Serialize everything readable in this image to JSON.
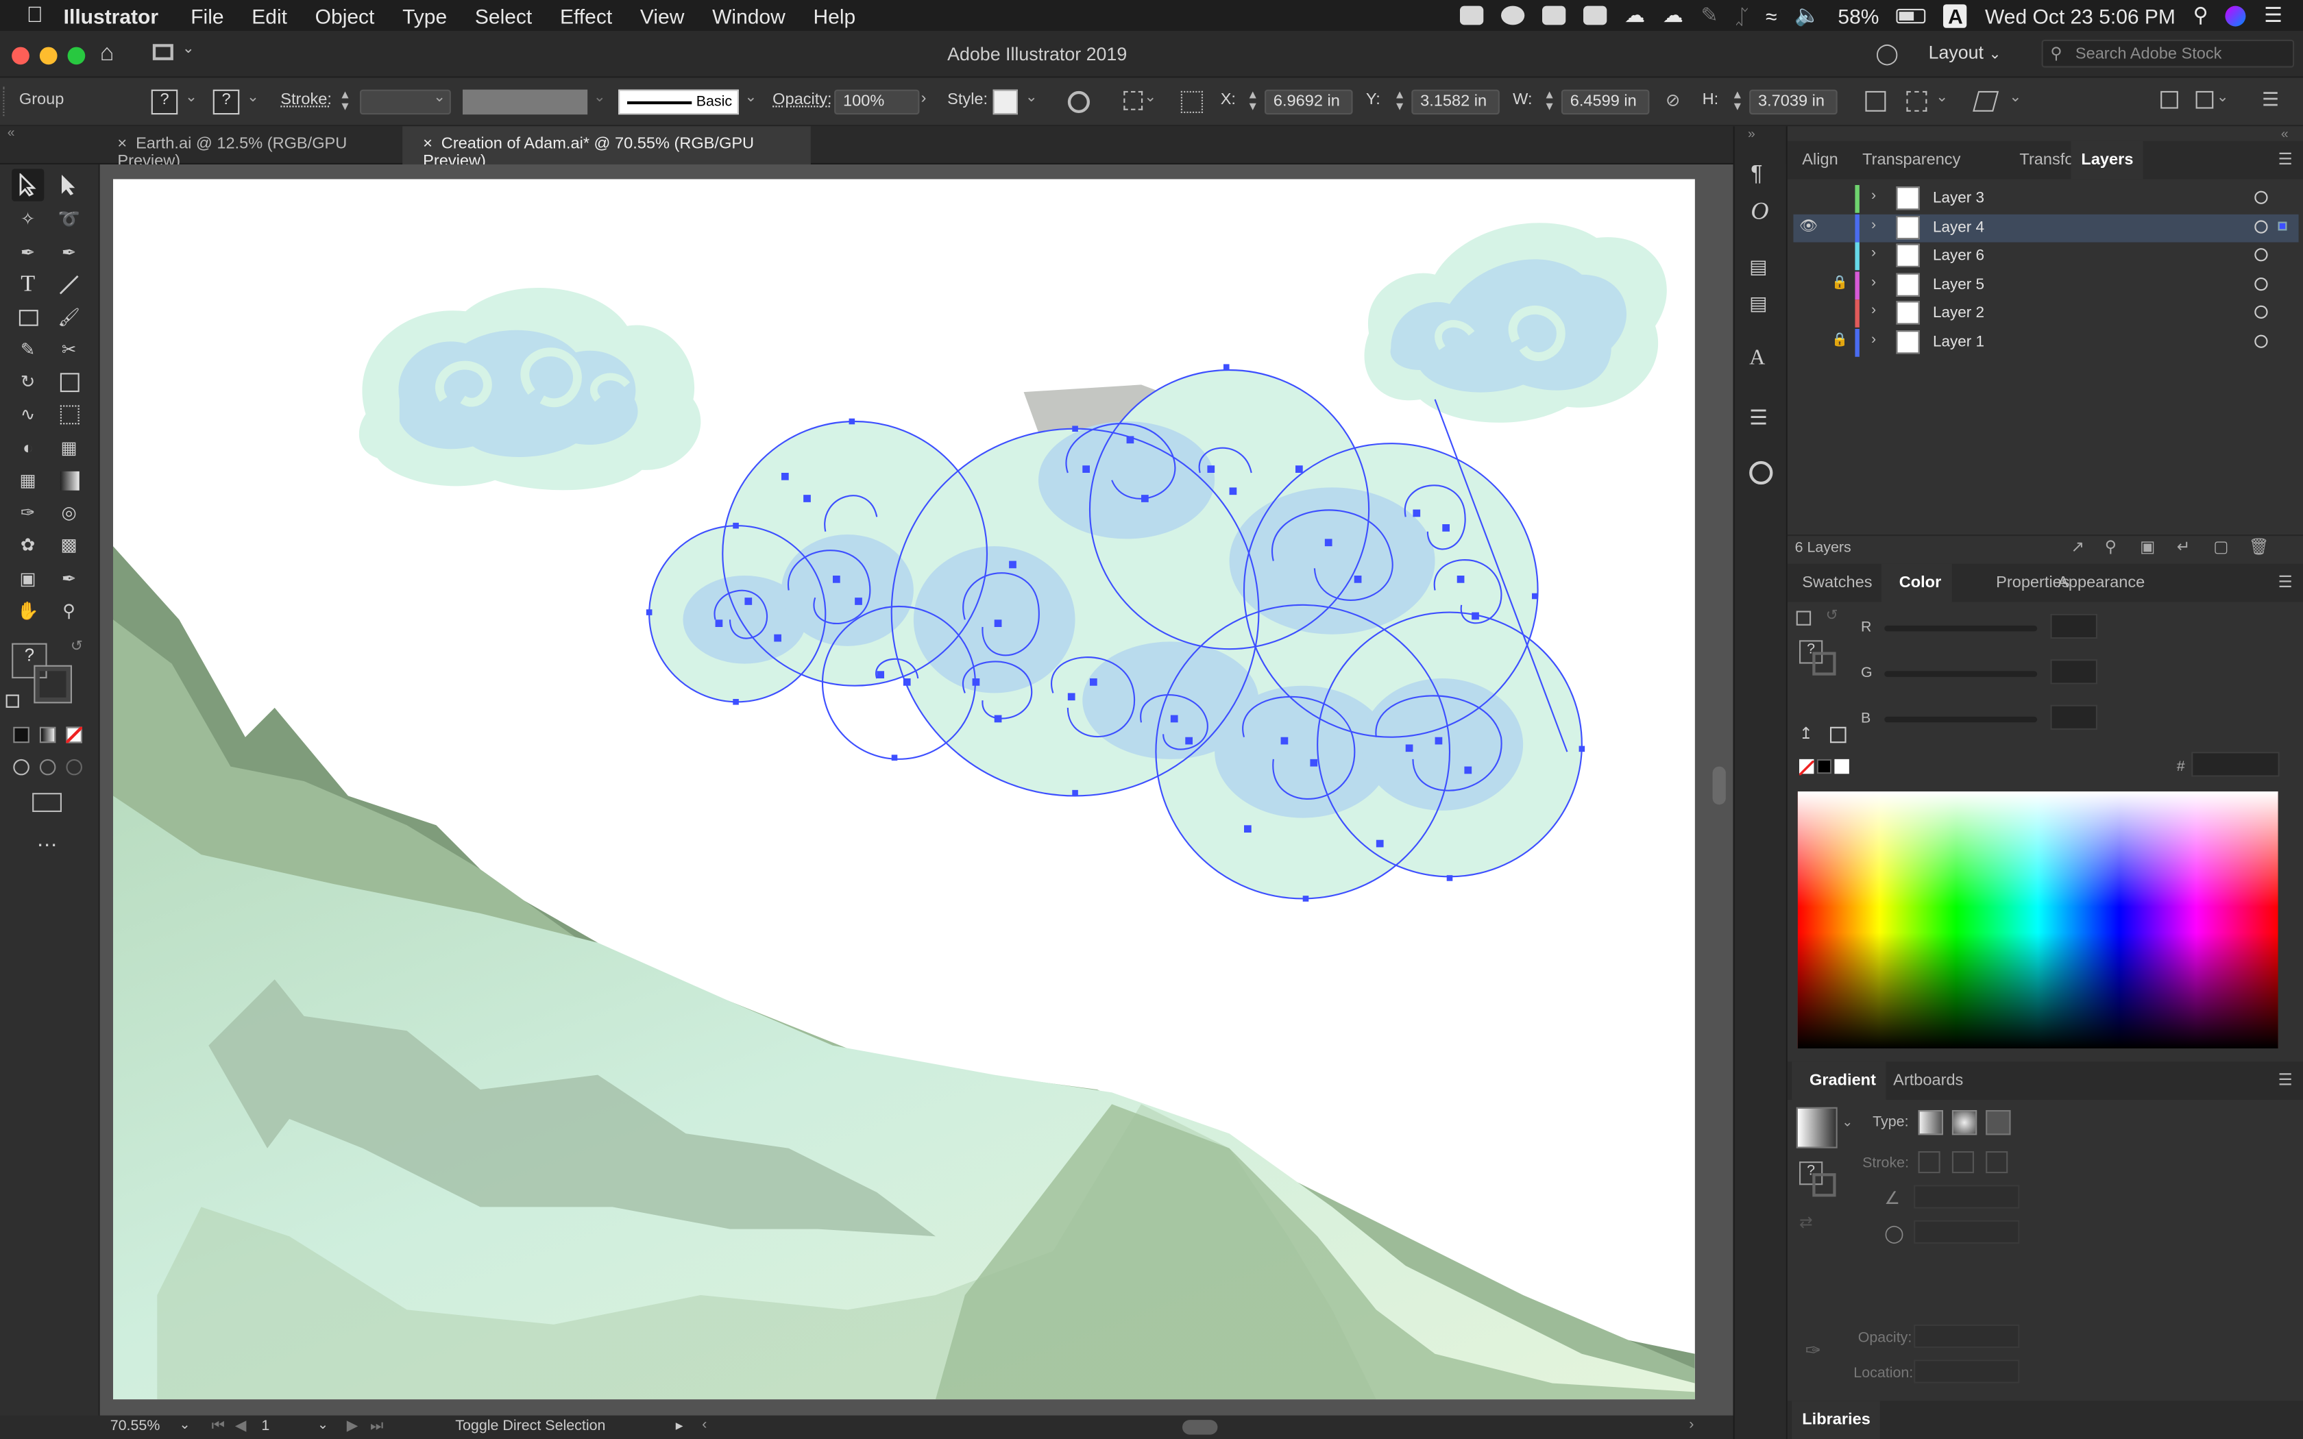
{
  "menubar": {
    "app": "Illustrator",
    "items": [
      "File",
      "Edit",
      "Object",
      "Type",
      "Select",
      "Effect",
      "View",
      "Window",
      "Help"
    ],
    "battery": "58%",
    "datetime": "Wed Oct 23  5:06 PM"
  },
  "titlebar": {
    "title": "Adobe Illustrator 2019",
    "workspace": "Layout",
    "search_placeholder": "Search Adobe Stock"
  },
  "controlbar": {
    "selection": "Group",
    "stroke_label": "Stroke:",
    "brush": "Basic",
    "opacity_label": "Opacity:",
    "opacity": "100%",
    "style_label": "Style:",
    "x_label": "X:",
    "x": "6.9692 in",
    "y_label": "Y:",
    "y": "3.1582 in",
    "w_label": "W:",
    "w": "6.4599 in",
    "h_label": "H:",
    "h": "3.7039 in",
    "fill_q": "?",
    "stroke_q": "?"
  },
  "tabs": [
    {
      "label": "Earth.ai @ 12.5% (RGB/GPU Preview)",
      "active": false
    },
    {
      "label": "Creation of Adam.ai* @ 70.55% (RGB/GPU Preview)",
      "active": true
    }
  ],
  "statusbar": {
    "zoom": "70.55%",
    "artboard": "1",
    "tool": "Toggle Direct Selection"
  },
  "layers_panel": {
    "tabs": [
      "Align",
      "Transparency",
      "Transform",
      "Layers"
    ],
    "active_tab": "Layers",
    "layers": [
      {
        "name": "Layer 3",
        "color": "#6fd36f",
        "visible": false,
        "locked": false,
        "selected": false
      },
      {
        "name": "Layer 4",
        "color": "#4a6cf0",
        "visible": true,
        "locked": false,
        "selected": true
      },
      {
        "name": "Layer 6",
        "color": "#66d8e8",
        "visible": false,
        "locked": false,
        "selected": false
      },
      {
        "name": "Layer 5",
        "color": "#d65ad6",
        "visible": false,
        "locked": true,
        "selected": false
      },
      {
        "name": "Layer 2",
        "color": "#e05a5a",
        "visible": false,
        "locked": false,
        "selected": false
      },
      {
        "name": "Layer 1",
        "color": "#4a6cf0",
        "visible": false,
        "locked": true,
        "selected": false
      }
    ],
    "count": "6 Layers"
  },
  "color_panel": {
    "tabs": [
      "Swatches",
      "Color",
      "Properties",
      "Appearance"
    ],
    "active_tab": "Color",
    "channels": [
      "R",
      "G",
      "B"
    ],
    "hex_label": "#"
  },
  "gradient_panel": {
    "tabs": [
      "Gradient",
      "Artboards"
    ],
    "active_tab": "Gradient",
    "type_label": "Type:",
    "stroke_label": "Stroke:",
    "opacity_label": "Opacity:",
    "location_label": "Location:"
  },
  "libraries": {
    "label": "Libraries"
  },
  "colors": {
    "selection": "#3d4fff",
    "cloud_fill": "#d6f3e6",
    "cloud_swirl": "#b8d8ec",
    "hill_light": "#cdebd8",
    "hill_mid": "#a8c7a4",
    "hill_dark": "#7d9a78"
  }
}
